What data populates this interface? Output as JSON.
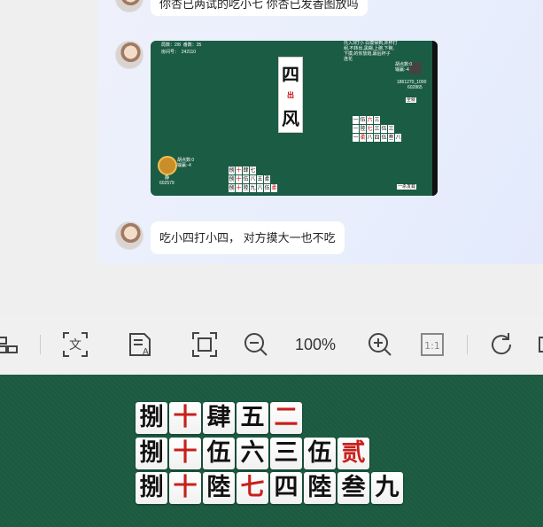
{
  "chat": {
    "top_message": "你杏已两试的吃小七  你杏已发香图放吗",
    "bottom_message": "吃小四打小四， 对方摸大一也不吃",
    "game_screenshot": {
      "center_tiles": [
        "四",
        "出",
        "风"
      ],
      "header": "局数：2/8  番数：35",
      "room": "房间号：  242110",
      "top_right_info": "托入3打小 白摸得到,并杯打\n组,不转出,黑糊,上碗,下碗,\n下摸,的你放炮,最后杯子\n连花",
      "left_player_score": "602579",
      "left_player_name": "静",
      "left_info": "胡点数:0\n输赢:-4",
      "right_player_id": "1861270_1000",
      "right_player_score": "602865",
      "right_info": "胡点数:0\n输赢:-4",
      "banker": "庄",
      "button_all_check": "全就",
      "button_bottom": "一杀发载"
    }
  },
  "toolbar": {
    "zoom": "100%",
    "icons": [
      "layout-icon",
      "translate-icon",
      "ocr-icon",
      "crop-icon",
      "zoom-out-icon",
      "zoom-in-icon",
      "actual-size-icon",
      "rotate-icon"
    ]
  },
  "hand": {
    "row1": [
      {
        "t": "捌",
        "red": false
      },
      {
        "t": "十",
        "red": true
      },
      {
        "t": "肆",
        "red": false
      },
      {
        "t": "五",
        "red": false
      },
      {
        "t": "二",
        "red": true
      }
    ],
    "row2": [
      {
        "t": "捌",
        "red": false
      },
      {
        "t": "十",
        "red": true
      },
      {
        "t": "伍",
        "red": false
      },
      {
        "t": "六",
        "red": false
      },
      {
        "t": "三",
        "red": false
      },
      {
        "t": "伍",
        "red": false
      },
      {
        "t": "贰",
        "red": true
      }
    ],
    "row3": [
      {
        "t": "捌",
        "red": false
      },
      {
        "t": "十",
        "red": true
      },
      {
        "t": "陸",
        "red": false
      },
      {
        "t": "七",
        "red": true
      },
      {
        "t": "四",
        "red": false
      },
      {
        "t": "陸",
        "red": false
      },
      {
        "t": "叁",
        "red": false
      },
      {
        "t": "九",
        "red": false
      }
    ]
  }
}
